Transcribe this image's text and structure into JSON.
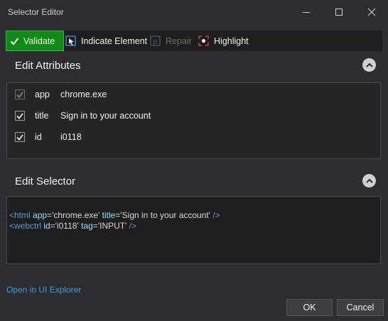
{
  "window": {
    "title": "Selector Editor"
  },
  "toolbar": {
    "validate": "Validate",
    "indicate": "Indicate Element",
    "repair": "Repair",
    "highlight": "Highlight"
  },
  "edit_attributes": {
    "title": "Edit Attributes",
    "rows": [
      {
        "name": "app",
        "value": "chrome.exe",
        "checked": true,
        "enabled": false
      },
      {
        "name": "title",
        "value": "Sign in to your account",
        "checked": true,
        "enabled": true
      },
      {
        "name": "id",
        "value": "i0118",
        "checked": true,
        "enabled": true
      }
    ]
  },
  "edit_selector": {
    "title": "Edit Selector",
    "line1": {
      "open": "<html",
      "a1n": " app=",
      "a1v": "'chrome.exe'",
      "a2n": " title=",
      "a2v": "'Sign in to your account'",
      "close": " />"
    },
    "line2": {
      "open": "<webctrl",
      "a1n": " id=",
      "a1v": "'i0118'",
      "a2n": " tag=",
      "a2v": "'INPUT'",
      "close": " />"
    }
  },
  "footer": {
    "open_explorer": "Open in UI Explorer",
    "ok": "OK",
    "cancel": "Cancel"
  },
  "colors": {
    "background": "#2d2d30",
    "validate_green": "#0e8a16",
    "link_blue": "#3c9ce6",
    "tag_blue": "#569cd6"
  }
}
